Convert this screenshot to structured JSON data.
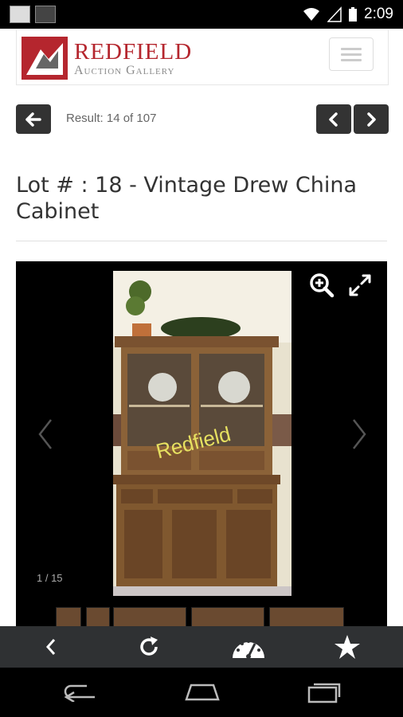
{
  "status_bar": {
    "time": "2:09"
  },
  "header": {
    "logo_title": "REDFIELD",
    "logo_subtitle": "Auction Gallery"
  },
  "navigation": {
    "result_text": "Result: 14 of 107"
  },
  "lot": {
    "title": "Lot # : 18 - Vintage Drew China Cabinet"
  },
  "gallery": {
    "counter": "1 / 15",
    "watermark": "Redfield"
  },
  "colors": {
    "brand_red": "#b5262e",
    "toolbar_bg": "#2f3133",
    "nav_button_bg": "#333333"
  },
  "icons": [
    "back-arrow-icon",
    "chevron-left-icon",
    "chevron-right-icon",
    "zoom-in-icon",
    "fullscreen-icon",
    "refresh-icon",
    "dashboard-icon",
    "star-icon",
    "android-back-icon",
    "android-home-icon",
    "android-recents-icon"
  ]
}
